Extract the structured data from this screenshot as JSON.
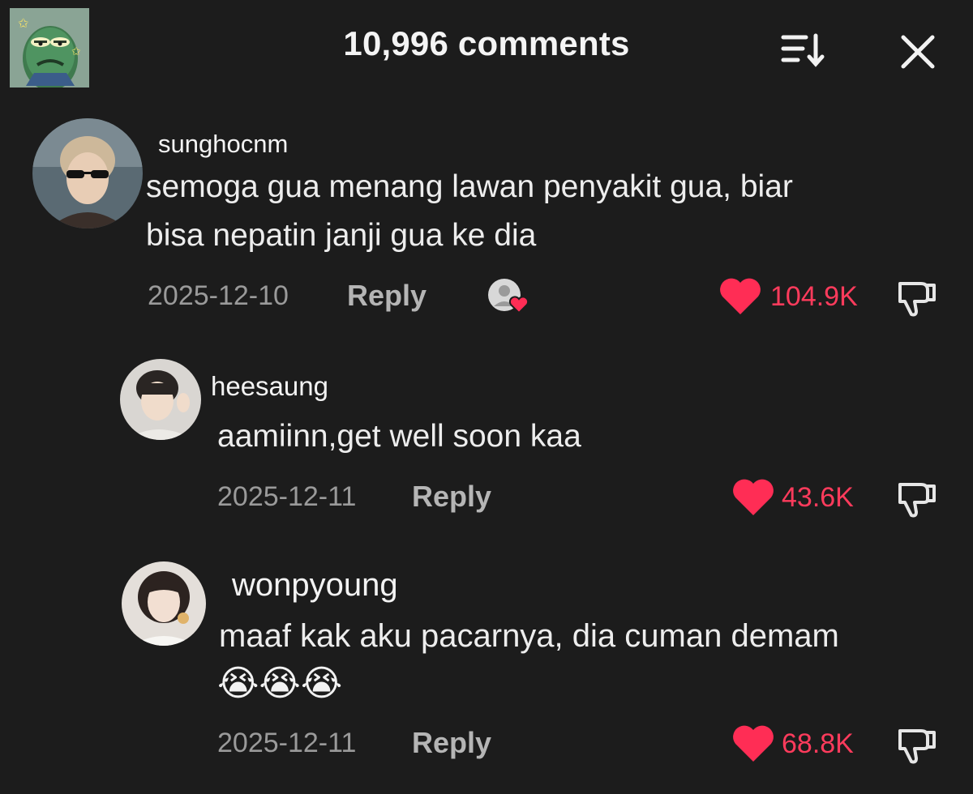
{
  "header": {
    "title": "10,996 comments"
  },
  "colors": {
    "background": "#1c1c1c",
    "like": "#ff2d55",
    "muted": "#9a9a9a"
  },
  "comments": [
    {
      "username": "sunghocnm",
      "text_line1": "semoga gua menang lawan penyakit gua, biar",
      "text_line2": "bisa nepatin janji gua ke dia",
      "date": "2025-12-10",
      "reply_label": "Reply",
      "likes": "104.9K",
      "creator_liked": true
    },
    {
      "username": "heesaung",
      "text_line1": "aamiinn,get well soon kaa",
      "date": "2025-12-11",
      "reply_label": "Reply",
      "likes": "43.6K"
    },
    {
      "username": "wonpyoung",
      "text_line1": "maaf kak aku pacarnya, dia cuman demam",
      "emoji": "😭😭😭",
      "date": "2025-12-11",
      "reply_label": "Reply",
      "likes": "68.8K"
    }
  ],
  "icons": {
    "sort": "sort-list-icon",
    "close": "close-icon",
    "like": "heart-icon",
    "dislike": "thumbs-down-icon",
    "creator_liked": "creator-liked-badge-icon"
  }
}
